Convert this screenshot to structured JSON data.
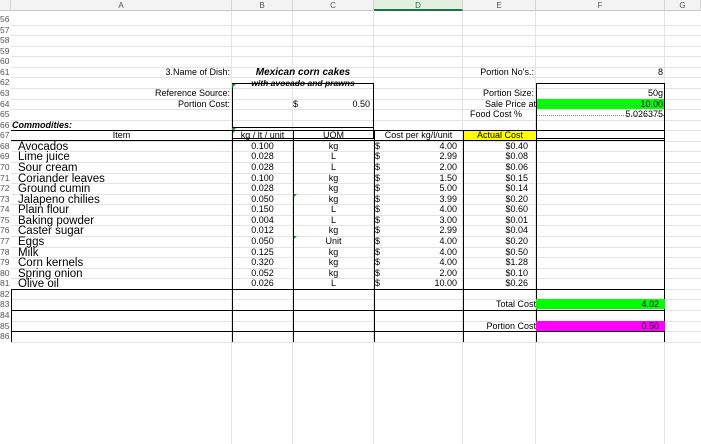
{
  "columns": [
    "A",
    "B",
    "C",
    "D",
    "E",
    "F",
    "G"
  ],
  "selected_column": "D",
  "rows": [
    "56",
    "57",
    "58",
    "59",
    "60",
    "61",
    "62",
    "63",
    "64",
    "65",
    "66",
    "67",
    "68",
    "69",
    "70",
    "71",
    "72",
    "73",
    "74",
    "75",
    "76",
    "77",
    "78",
    "79",
    "80",
    "81",
    "82",
    "83",
    "84",
    "85",
    "86"
  ],
  "dish": {
    "label": "3.Name of Dish:",
    "name_line1": "Mexican corn cakes",
    "name_line2": "with avocado and prawns",
    "ref_label": "Reference Source:",
    "portion_cost_label": "Portion Cost:",
    "currency": "$",
    "portion_cost": "0.50"
  },
  "summary": {
    "portion_no_label": "Portion No's.:",
    "portion_no": "8",
    "portion_size_label": "Portion Size:",
    "portion_size": "50g",
    "sale_price_label": "Sale Price at",
    "sale_price": "10.00",
    "food_cost_label": "Food Cost %",
    "food_cost": "5.026375",
    "total_cost_label": "Total Cost",
    "total_cost": "4.02",
    "portion_cost_label": "Portion Cost",
    "portion_cost": "0.50"
  },
  "commodities_label": "Commodities:",
  "headers": {
    "item": "Item",
    "qty": "kg / lt / unit",
    "uom": "UOM",
    "cost": "Cost per kg/l/unit",
    "actual": "Actual Cost"
  },
  "items": [
    {
      "name": "Avocados",
      "qty": "0.100",
      "uom": "kg",
      "cost": "4.00",
      "actual": "$0.40"
    },
    {
      "name": "Lime juice",
      "qty": "0.028",
      "uom": "L",
      "cost": "2.99",
      "actual": "$0.08"
    },
    {
      "name": "Sour cream",
      "qty": "0.028",
      "uom": "L",
      "cost": "2.00",
      "actual": "$0.06"
    },
    {
      "name": "Coriander leaves",
      "qty": "0.100",
      "uom": "kg",
      "cost": "1.50",
      "actual": "$0.15"
    },
    {
      "name": "Ground cumin",
      "qty": "0.028",
      "uom": "kg",
      "cost": "5.00",
      "actual": "$0.14"
    },
    {
      "name": "Jalapeno chilies",
      "qty": "0.050",
      "uom": "kg",
      "cost": "3.99",
      "actual": "$0.20"
    },
    {
      "name": "Plain flour",
      "qty": "0.150",
      "uom": "L",
      "cost": "4.00",
      "actual": "$0.60"
    },
    {
      "name": "Baking powder",
      "qty": "0.004",
      "uom": "L",
      "cost": "3.00",
      "actual": "$0.01"
    },
    {
      "name": "Caster sugar",
      "qty": "0.012",
      "uom": "kg",
      "cost": "2.99",
      "actual": "$0.04"
    },
    {
      "name": "Eggs",
      "qty": "0.050",
      "uom": "Unit",
      "cost": "4.00",
      "actual": "$0.20"
    },
    {
      "name": "Milk",
      "qty": "0.125",
      "uom": "kg",
      "cost": "4.00",
      "actual": "$0.50"
    },
    {
      "name": "Corn kernels",
      "qty": "0.320",
      "uom": "kg",
      "cost": "4.00",
      "actual": "$1.28"
    },
    {
      "name": "Spring onion",
      "qty": "0.052",
      "uom": "kg",
      "cost": "2.00",
      "actual": "$0.10"
    },
    {
      "name": "Olive oil",
      "qty": "0.026",
      "uom": "L",
      "cost": "10.00",
      "actual": "$0.26"
    }
  ]
}
